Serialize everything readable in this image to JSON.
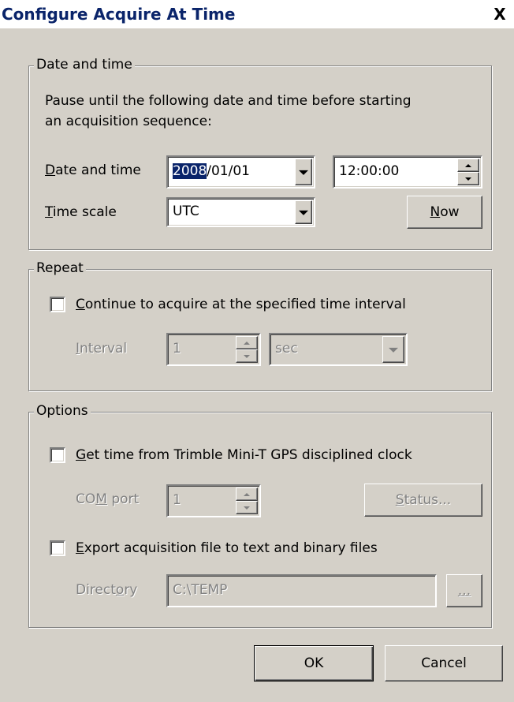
{
  "window": {
    "title": "Configure Acquire At Time",
    "close_glyph": "X"
  },
  "datetime_group": {
    "legend": "Date and time",
    "description_line1": "Pause until the following date and time before starting",
    "description_line2": "an acquisition sequence:",
    "date_label_u": "D",
    "date_label_rest": "ate and time",
    "date_selected": "2008",
    "date_rest": "/01/01",
    "time_value": "12:00:00",
    "timescale_label_u": "T",
    "timescale_label_rest": "ime scale",
    "timescale_value": "UTC",
    "now_u": "N",
    "now_rest": "ow"
  },
  "repeat_group": {
    "legend": "Repeat",
    "checkbox_u": "C",
    "checkbox_rest": "ontinue to acquire at the specified time interval",
    "checked": false,
    "interval_label_u": "I",
    "interval_label_rest": "nterval",
    "interval_value": "1",
    "unit_value": "sec"
  },
  "options_group": {
    "legend": "Options",
    "gps_checkbox_u": "G",
    "gps_checkbox_rest": "et time from Trimble Mini-T GPS disciplined clock",
    "gps_checked": false,
    "com_label_pre": "CO",
    "com_label_u": "M",
    "com_label_post": " port",
    "com_value": "1",
    "status_u": "S",
    "status_rest": "tatus...",
    "export_checkbox_u": "E",
    "export_checkbox_rest": "xport acquisition file to text and binary files",
    "export_checked": false,
    "dir_label_pre": "Direct",
    "dir_label_u": "o",
    "dir_label_post": "ry",
    "dir_value": "C:\\TEMP",
    "browse_label": "..."
  },
  "buttons": {
    "ok": "OK",
    "cancel": "Cancel"
  },
  "colors": {
    "face": "#d4d0c8",
    "title_text": "#0a246a",
    "selection": "#0a246a",
    "disabled_text": "#808080"
  }
}
